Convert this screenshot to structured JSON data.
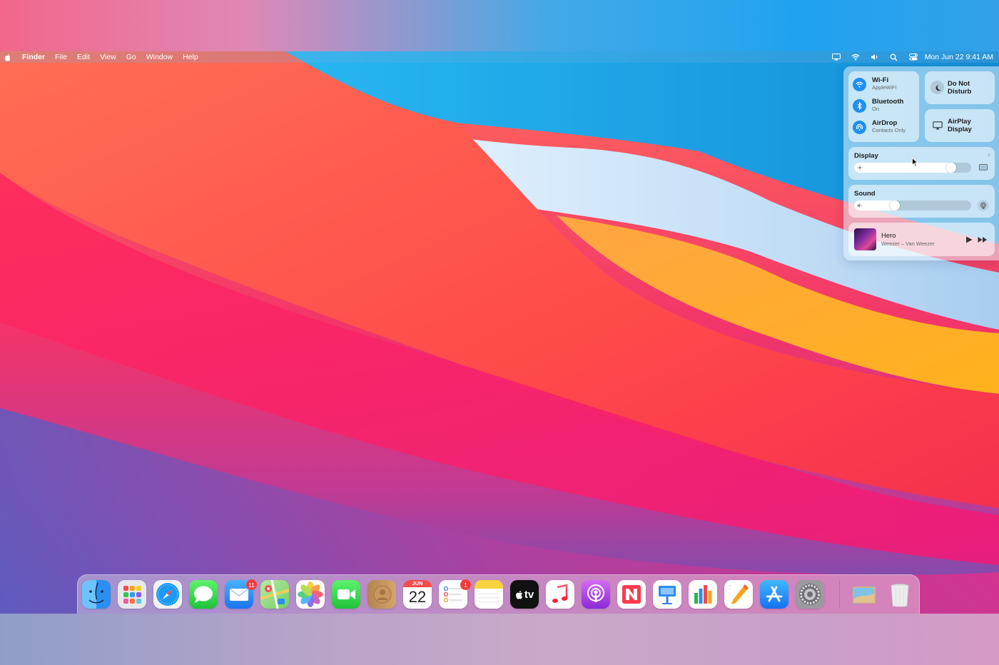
{
  "menubar": {
    "app_name": "Finder",
    "menus": [
      "File",
      "Edit",
      "View",
      "Go",
      "Window",
      "Help"
    ],
    "status_icons": [
      "airplay-icon",
      "wifi-icon",
      "volume-icon",
      "spotlight-icon",
      "control-center-icon"
    ],
    "clock": "Mon Jun 22  9:41 AM"
  },
  "control_center": {
    "wifi": {
      "label": "Wi-Fi",
      "status": "AppleWiFi"
    },
    "bluetooth": {
      "label": "Bluetooth",
      "status": "On"
    },
    "airdrop": {
      "label": "AirDrop",
      "status": "Contacts Only"
    },
    "do_not_disturb": {
      "line1": "Do Not",
      "line2": "Disturb"
    },
    "airplay_display": {
      "line1": "AirPlay",
      "line2": "Display"
    },
    "display": {
      "label": "Display",
      "brightness": 0.86
    },
    "sound": {
      "label": "Sound",
      "volume": 0.33
    },
    "now_playing": {
      "title": "Hero",
      "artist": "Weezer – Van Weezer"
    }
  },
  "dock": {
    "apps": [
      {
        "name": "Finder",
        "icon": "finder-icon",
        "color": "#3aa0f0"
      },
      {
        "name": "Launchpad",
        "icon": "launchpad-icon",
        "color": "#e6e6ea"
      },
      {
        "name": "Safari",
        "icon": "safari-icon",
        "color": "#ffffff"
      },
      {
        "name": "Messages",
        "icon": "messages-icon",
        "color": "#2bd14a"
      },
      {
        "name": "Mail",
        "icon": "mail-icon",
        "color": "#2f8ff5",
        "badge": "11"
      },
      {
        "name": "Maps",
        "icon": "maps-icon",
        "color": "#7fd07a"
      },
      {
        "name": "Photos",
        "icon": "photos-icon",
        "color": "#ffffff"
      },
      {
        "name": "FaceTime",
        "icon": "facetime-icon",
        "color": "#2bd14a"
      },
      {
        "name": "Contacts",
        "icon": "contacts-icon",
        "color": "#c99a62"
      },
      {
        "name": "Calendar",
        "icon": "calendar-icon",
        "color": "#ffffff",
        "month": "JUN",
        "day": "22"
      },
      {
        "name": "Reminders",
        "icon": "reminders-icon",
        "color": "#ffffff",
        "badge": "1"
      },
      {
        "name": "Notes",
        "icon": "notes-icon",
        "color": "#ffffff"
      },
      {
        "name": "TV",
        "icon": "tv-icon",
        "color": "#111111",
        "text": "tv"
      },
      {
        "name": "Music",
        "icon": "music-icon",
        "color": "#ffffff"
      },
      {
        "name": "Podcasts",
        "icon": "podcasts-icon",
        "color": "#a33fe0"
      },
      {
        "name": "News",
        "icon": "news-icon",
        "color": "#ffffff"
      },
      {
        "name": "Keynote",
        "icon": "keynote-icon",
        "color": "#ffffff"
      },
      {
        "name": "Numbers",
        "icon": "numbers-icon",
        "color": "#ffffff"
      },
      {
        "name": "Pages",
        "icon": "pages-icon",
        "color": "#ffffff"
      },
      {
        "name": "App Store",
        "icon": "app-store-icon",
        "color": "#1e90f5"
      },
      {
        "name": "System Preferences",
        "icon": "system-preferences-icon",
        "color": "#8a8a8e"
      }
    ],
    "extras": [
      {
        "name": "Downloads stack",
        "icon": "downloads-stack-icon"
      },
      {
        "name": "Trash",
        "icon": "trash-icon"
      }
    ]
  }
}
